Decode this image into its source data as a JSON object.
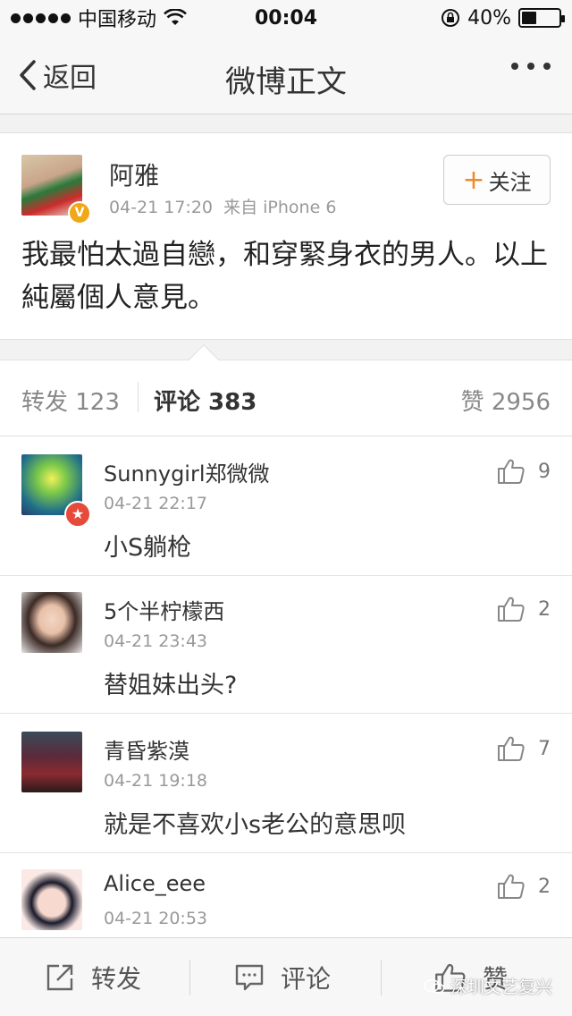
{
  "status_bar": {
    "carrier": "中国移动",
    "time": "00:04",
    "battery": "40%",
    "battery_level": 0.4
  },
  "nav": {
    "back_label": "返回",
    "title": "微博正文"
  },
  "post": {
    "user": "阿雅",
    "time": "04-21 17:20",
    "source": "来自 iPhone 6",
    "follow_label": "关注",
    "text": "我最怕太過自戀，和穿緊身衣的男人。以上純屬個人意見。",
    "verified_badge": "V"
  },
  "tabs": {
    "repost": "转发 123",
    "comment": "评论 383",
    "like": "赞 2956"
  },
  "comments": [
    {
      "name": "Sunnygirl郑微微",
      "time": "04-21 22:17",
      "text": "小S躺枪",
      "likes": "9"
    },
    {
      "name": "5个半柠檬西",
      "time": "04-21 23:43",
      "text": "替姐妹出头?",
      "likes": "2"
    },
    {
      "name": "青昏紫漠",
      "time": "04-21 19:18",
      "text": "就是不喜欢小s老公的意思呗",
      "likes": "7"
    },
    {
      "name": "Alice_eee",
      "time": "04-21 20:53",
      "text": "",
      "likes": "2"
    }
  ],
  "bottom_bar": {
    "repost": "转发",
    "comment": "评论",
    "like": "赞"
  },
  "watermark": "深圳文艺复兴",
  "colors": {
    "accent_orange": "#f08a24",
    "verified_yellow": "#f0a817"
  }
}
